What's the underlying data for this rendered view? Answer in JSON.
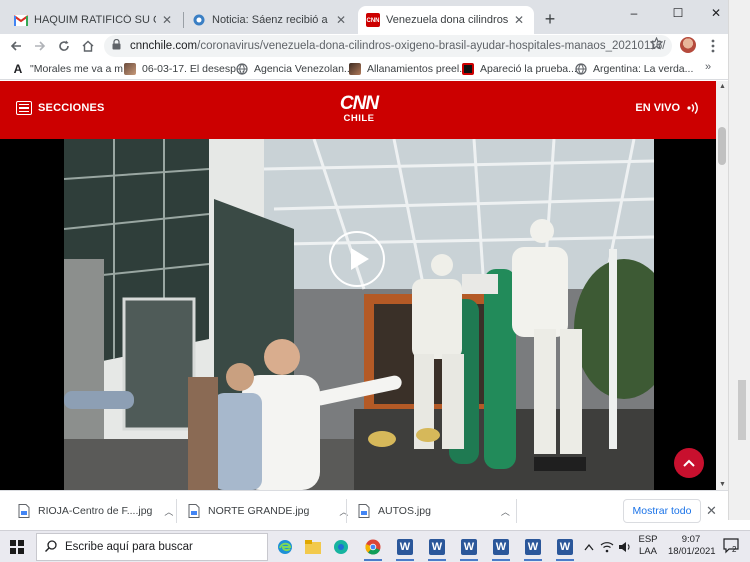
{
  "browser": {
    "tabs": [
      {
        "title": "HAQUIM RATIFICÓ SU COMPROMISO",
        "favicon": "gmail-icon",
        "active": false
      },
      {
        "title": "Noticia: Sáenz recibió a Kevin Be",
        "favicon": "news-globe-icon",
        "active": false
      },
      {
        "title": "Venezuela dona cilindros de oxíge",
        "favicon": "cnn-icon",
        "active": true
      }
    ],
    "tab_close_glyph": "✕",
    "new_tab_glyph": "+",
    "window_controls": [
      "–",
      "☐",
      "✕"
    ],
    "url_host": "cnnchile.com",
    "url_path": "/coronavirus/venezuela-dona-cilindros-oxigeno-brasil-ayudar-hospitales-manaos_20210116/",
    "bookmarks": [
      {
        "label": "\"Morales me va a m...",
        "icon": "font-a-icon"
      },
      {
        "label": "06-03-17. El desesp...",
        "icon": "photo-thumb-icon"
      },
      {
        "label": "Agencia Venezolan...",
        "icon": "globe-icon"
      },
      {
        "label": "Allanamientos preel...",
        "icon": "photo-thumb-icon"
      },
      {
        "label": "Apareció la prueba...",
        "icon": "red-logo-icon"
      },
      {
        "label": "Argentina: La verda...",
        "icon": "globe-icon"
      }
    ],
    "bookmarks_more": "»"
  },
  "page": {
    "header": {
      "menu_label": "SECCIONES",
      "logo_main": "CNN",
      "logo_sub": "CHILE",
      "live_label": "EN VIVO"
    },
    "colors": {
      "brand_red": "#cc0000",
      "to_top_red": "#c8102e"
    }
  },
  "downloads": {
    "items": [
      {
        "name": "RIOJA-Centro de F....jpg"
      },
      {
        "name": "NORTE GRANDE.jpg"
      },
      {
        "name": "AUTOS.jpg"
      }
    ],
    "show_all": "Mostrar todo",
    "close_glyph": "✕"
  },
  "taskbar": {
    "search_placeholder": "Escribe aquí para buscar",
    "lang_line1": "ESP",
    "lang_line2": "LAA",
    "time": "9:07",
    "date": "18/01/2021",
    "notification_count": "2"
  }
}
